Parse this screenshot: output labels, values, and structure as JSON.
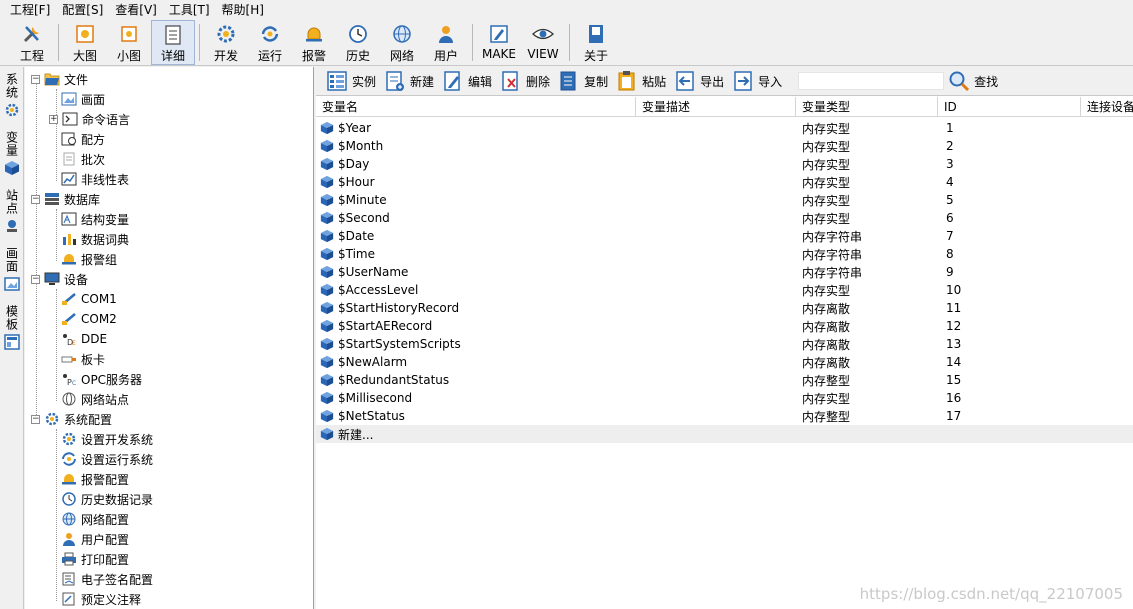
{
  "menu": [
    "工程[F]",
    "配置[S]",
    "查看[V]",
    "工具[T]",
    "帮助[H]"
  ],
  "toolbar": {
    "items": [
      {
        "label": "工程",
        "icon": "tools-icon"
      },
      {
        "label": "大图",
        "icon": "large-icons-icon"
      },
      {
        "label": "小图",
        "icon": "small-icons-icon"
      },
      {
        "label": "详细",
        "icon": "details-icon"
      },
      {
        "label": "开发",
        "icon": "develop-gear-icon"
      },
      {
        "label": "运行",
        "icon": "run-icon"
      },
      {
        "label": "报警",
        "icon": "alarm-bell-icon"
      },
      {
        "label": "历史",
        "icon": "history-clock-icon"
      },
      {
        "label": "网络",
        "icon": "network-globe-icon"
      },
      {
        "label": "用户",
        "icon": "user-icon"
      },
      {
        "label": "MAKE",
        "icon": "make-edit-icon"
      },
      {
        "label": "VIEW",
        "icon": "view-eye-icon"
      },
      {
        "label": "关于",
        "icon": "about-book-icon"
      }
    ]
  },
  "vtabs": [
    "系统",
    "变量",
    "站点",
    "画面",
    "模板"
  ],
  "tree": {
    "file": {
      "label": "文件",
      "children": [
        "画面",
        "命令语言",
        "配方",
        "批次",
        "非线性表"
      ]
    },
    "database": {
      "label": "数据库",
      "children": [
        "结构变量",
        "数据词典",
        "报警组"
      ]
    },
    "device": {
      "label": "设备",
      "children": [
        "COM1",
        "COM2",
        "DDE",
        "板卡",
        "OPC服务器",
        "网络站点"
      ]
    },
    "sysconfig": {
      "label": "系统配置",
      "children": [
        "设置开发系统",
        "设置运行系统",
        "报警配置",
        "历史数据记录",
        "网络配置",
        "用户配置",
        "打印配置",
        "电子签名配置",
        "预定义注释"
      ]
    }
  },
  "rtoolbar": {
    "instance": "实例",
    "new": "新建",
    "edit": "编辑",
    "delete": "删除",
    "copy": "复制",
    "paste": "粘贴",
    "export": "导出",
    "import": "导入",
    "search_value": "",
    "find": "查找"
  },
  "table": {
    "headers": [
      "变量名",
      "变量描述",
      "变量类型",
      "ID",
      "连接设备"
    ],
    "rows": [
      [
        "$Year",
        "",
        "内存实型",
        "1"
      ],
      [
        "$Month",
        "",
        "内存实型",
        "2"
      ],
      [
        "$Day",
        "",
        "内存实型",
        "3"
      ],
      [
        "$Hour",
        "",
        "内存实型",
        "4"
      ],
      [
        "$Minute",
        "",
        "内存实型",
        "5"
      ],
      [
        "$Second",
        "",
        "内存实型",
        "6"
      ],
      [
        "$Date",
        "",
        "内存字符串",
        "7"
      ],
      [
        "$Time",
        "",
        "内存字符串",
        "8"
      ],
      [
        "$UserName",
        "",
        "内存字符串",
        "9"
      ],
      [
        "$AccessLevel",
        "",
        "内存实型",
        "10"
      ],
      [
        "$StartHistoryRecord",
        "",
        "内存离散",
        "11"
      ],
      [
        "$StartAERecord",
        "",
        "内存离散",
        "12"
      ],
      [
        "$StartSystemScripts",
        "",
        "内存离散",
        "13"
      ],
      [
        "$NewAlarm",
        "",
        "内存离散",
        "14"
      ],
      [
        "$RedundantStatus",
        "",
        "内存整型",
        "15"
      ],
      [
        "$Millisecond",
        "",
        "内存实型",
        "16"
      ],
      [
        "$NetStatus",
        "",
        "内存整型",
        "17"
      ]
    ],
    "new_row": "新建..."
  },
  "watermark": "https://blog.csdn.net/qq_22107005",
  "colors": {
    "accent_blue": "#2f6db5",
    "cube_blue": "#2a66b8",
    "alarm_yellow": "#f2b01e"
  }
}
